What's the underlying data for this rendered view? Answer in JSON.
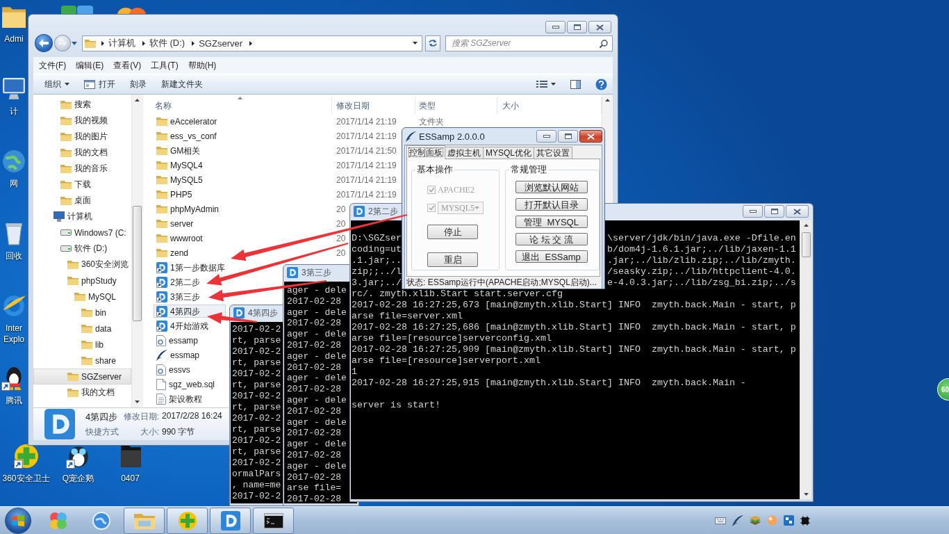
{
  "desktop": {
    "left_icons": [
      {
        "kind": "folder",
        "label": "Admi",
        "shortcut": false
      },
      {
        "kind": "computer",
        "label": "计",
        "shortcut": false
      },
      {
        "kind": "network",
        "label": "网",
        "shortcut": false
      },
      {
        "kind": "recycle-bin",
        "label": "回收",
        "shortcut": false
      },
      {
        "kind": "browser",
        "label": "Inter Explo",
        "shortcut": false
      },
      {
        "kind": "penguin",
        "label": "腾讯",
        "shortcut": true
      }
    ],
    "bottom_icons": [
      {
        "kind": "plus-shield",
        "label": "360安全卫士",
        "shortcut": true
      },
      {
        "kind": "pet",
        "label": "Q宠企鹅",
        "shortcut": true
      },
      {
        "kind": "dark-folder",
        "label": "0407",
        "shortcut": false
      }
    ],
    "side_widget": {
      "text": "60"
    }
  },
  "explorer": {
    "breadcrumb": [
      "计算机",
      "软件 (D:)",
      "SGZserver"
    ],
    "search": {
      "placeholder": "搜索 SGZserver"
    },
    "menu": [
      "文件(F)",
      "编辑(E)",
      "查看(V)",
      "工具(T)",
      "帮助(H)"
    ],
    "toolbar": [
      {
        "label": "组织",
        "kind": "menu"
      },
      {
        "label": "打开",
        "kind": "open"
      },
      {
        "label": "刻录",
        "kind": "plain"
      },
      {
        "label": "新建文件夹",
        "kind": "plain"
      }
    ],
    "nav_upper": [
      {
        "label": "搜索",
        "kind": "folder",
        "selected": false
      },
      {
        "label": "我的视频",
        "kind": "folder",
        "selected": false
      },
      {
        "label": "我的图片",
        "kind": "folder",
        "selected": false
      },
      {
        "label": "我的文档",
        "kind": "folder",
        "selected": false
      },
      {
        "label": "我的音乐",
        "kind": "folder",
        "selected": false
      },
      {
        "label": "下载",
        "kind": "folder",
        "selected": false
      },
      {
        "label": "桌面",
        "kind": "folder",
        "selected": false
      }
    ],
    "nav_tree": [
      {
        "label": "计算机",
        "kind": "computer",
        "selected": false,
        "children": [
          {
            "label": "Windows7 (C:",
            "kind": "drive",
            "selected": false
          },
          {
            "label": "软件 (D:)",
            "kind": "drive",
            "selected": false,
            "children": [
              {
                "label": "360安全浏览",
                "kind": "folder",
                "selected": false
              },
              {
                "label": "phpStudy",
                "kind": "folder",
                "selected": false,
                "children": [
                  {
                    "label": "MySQL",
                    "kind": "folder",
                    "selected": false,
                    "children": [
                      {
                        "label": "bin",
                        "kind": "folder",
                        "selected": false
                      },
                      {
                        "label": "data",
                        "kind": "folder",
                        "selected": false
                      },
                      {
                        "label": "lib",
                        "kind": "folder",
                        "selected": false
                      },
                      {
                        "label": "share",
                        "kind": "folder",
                        "selected": false
                      }
                    ]
                  }
                ]
              },
              {
                "label": "SGZserver",
                "kind": "folder",
                "selected": true
              },
              {
                "label": "我的文档",
                "kind": "folder",
                "selected": false
              }
            ]
          }
        ]
      }
    ],
    "columns": [
      "名称",
      "修改日期",
      "类型",
      "大小"
    ],
    "files": [
      {
        "name": "eAccelerator",
        "kind": "folder",
        "date": "2017/1/14 21:19",
        "type": "文件夹",
        "selected": false
      },
      {
        "name": "ess_vs_conf",
        "kind": "folder",
        "date": "2017/1/14 21:19",
        "selected": false
      },
      {
        "name": "GM相关",
        "kind": "folder",
        "date": "2017/1/14 21:50",
        "selected": false
      },
      {
        "name": "MySQL4",
        "kind": "folder",
        "date": "2017/1/14 21:19",
        "selected": false
      },
      {
        "name": "MySQL5",
        "kind": "folder",
        "date": "2017/1/14 21:19",
        "selected": false
      },
      {
        "name": "PHP5",
        "kind": "folder",
        "date": "2017/1/14 21:19",
        "selected": false
      },
      {
        "name": "phpMyAdmin",
        "kind": "folder",
        "date": "20",
        "selected": false
      },
      {
        "name": "server",
        "kind": "folder",
        "date": "20",
        "selected": false
      },
      {
        "name": "wwwroot",
        "kind": "folder",
        "date": "20",
        "selected": false
      },
      {
        "name": "zend",
        "kind": "folder",
        "date": "20",
        "selected": false
      },
      {
        "name": "1第一步数据库",
        "kind": "shortcut",
        "selected": false
      },
      {
        "name": "2第二步",
        "kind": "shortcut",
        "selected": false
      },
      {
        "name": "3第三步",
        "kind": "shortcut",
        "selected": false
      },
      {
        "name": "4第四步",
        "kind": "shortcut",
        "selected": true
      },
      {
        "name": "4开始游戏",
        "kind": "shortcut",
        "selected": false
      },
      {
        "name": "essamp",
        "kind": "config",
        "selected": false
      },
      {
        "name": "essmap",
        "kind": "feather",
        "selected": false
      },
      {
        "name": "essvs",
        "kind": "config",
        "selected": false
      },
      {
        "name": "sgz_web.sql",
        "kind": "file",
        "selected": false
      },
      {
        "name": "架设教程",
        "kind": "document",
        "selected": false
      }
    ],
    "details": {
      "name": "4第四步",
      "date_label": "修改日期:",
      "date": "2017/2/28 16:24",
      "type": "快捷方式",
      "size_label": "大小:",
      "size": "990 字节"
    }
  },
  "consoles": [
    {
      "title": "4第四步",
      "lines": [
        {
          "text": "2017-02-2"
        },
        {
          "text": "rt, parse"
        },
        {
          "text": "2017-02-2"
        },
        {
          "text": "rt, parse"
        },
        {
          "text": "2017-02-2"
        },
        {
          "text": "rt, parse"
        },
        {
          "text": "2017-02-2"
        },
        {
          "text": "rt, parse"
        },
        {
          "text": "2017-02-2"
        },
        {
          "text": "rt, parse"
        },
        {
          "text": "2017-02-2"
        },
        {
          "text": "rt, parse"
        },
        {
          "text": "2017-02-2"
        },
        {
          "text": "ormalPars"
        },
        {
          "text": ", name=me"
        },
        {
          "text": "2017-02-2"
        }
      ]
    },
    {
      "title": "3第三步",
      "lines": [
        {
          "text": "ager - dele"
        },
        {
          "text": "2017-02-28"
        },
        {
          "text": "ager - dele"
        },
        {
          "text": "2017-02-28"
        },
        {
          "text": "ager - dele"
        },
        {
          "text": "2017-02-28"
        },
        {
          "text": "ager - dele"
        },
        {
          "text": "2017-02-28"
        },
        {
          "text": "ager - dele"
        },
        {
          "text": "2017-02-28"
        },
        {
          "text": "ager - dele"
        },
        {
          "text": "2017-02-28"
        },
        {
          "text": "ager - dele"
        },
        {
          "text": "2017-02-28"
        },
        {
          "text": "ager - dele"
        },
        {
          "text": "2017-02-28"
        },
        {
          "text": "ager - dele"
        },
        {
          "text": "2017-02-28"
        },
        {
          "text": "arse file="
        },
        {
          "text": "2017-02-28"
        }
      ]
    },
    {
      "title": "2第二步",
      "lines": [
        {
          "kind": "split",
          "left": "D:\\SGZser",
          "right": "\\server/jdk/bin/java.exe -Dfile.en"
        },
        {
          "kind": "split",
          "left": "coding=ut",
          "right": "b/dom4j-1.6.1.jar;../lib/jaxen-1.1"
        },
        {
          "kind": "split",
          "left": ".1.jar;..",
          "right": ".jar;../lib/zlib.zip;../lib/zmyth."
        },
        {
          "kind": "split",
          "left": "zip;;../l",
          "right": "/seasky.zip;../lib/httpclient-4.0."
        },
        {
          "kind": "split",
          "left": "3.jar;../",
          "right": "e-4.0.3.jar;../lib/zsg_bi.zip;../s"
        },
        {
          "kind": "text",
          "text": "rc/. zmyth.xlib.Start start.server.cfg"
        },
        {
          "kind": "text",
          "text": "2017-02-28 16:27:25,673 [main@zmyth.xlib.Start] INFO  zmyth.back.Main - start, p"
        },
        {
          "kind": "text",
          "text": "arse file=server.xml"
        },
        {
          "kind": "text",
          "text": "2017-02-28 16:27:25,686 [main@zmyth.xlib.Start] INFO  zmyth.back.Main - start, p"
        },
        {
          "kind": "text",
          "text": "arse file=[resource]serverconfig.xml"
        },
        {
          "kind": "text",
          "text": "2017-02-28 16:27:25,909 [main@zmyth.xlib.Start] INFO  zmyth.back.Main - start, p"
        },
        {
          "kind": "text",
          "text": "arse file=[resource]serverport.xml"
        },
        {
          "kind": "text",
          "text": "1"
        },
        {
          "kind": "text",
          "text": "2017-02-28 16:27:25,915 [main@zmyth.xlib.Start] INFO  zmyth.back.Main -"
        },
        {
          "kind": "blank"
        },
        {
          "kind": "text",
          "text": "server is start!"
        }
      ]
    }
  ],
  "essamp": {
    "title": "ESSamp 2.0.0.0",
    "tabs": [
      {
        "label": "控制面板",
        "selected": true
      },
      {
        "label": "虚拟主机",
        "selected": false
      },
      {
        "label": "MYSQL优化",
        "selected": false
      },
      {
        "label": "其它设置",
        "selected": false
      }
    ],
    "basic": {
      "title": "基本操作",
      "options": [
        {
          "label": "APACHE2",
          "checked": true,
          "disabled": true
        },
        {
          "dropdown": "MYSQL5",
          "checked": true,
          "disabled": true
        }
      ],
      "buttons": [
        "停止",
        "重启"
      ]
    },
    "manage": {
      "title": "常规管理",
      "buttons": [
        "浏览默认网站",
        "打开默认目录",
        "管理  MYSQL",
        "论 坛 交 流",
        "退出  ESSamp"
      ]
    },
    "status": "状态: ESSamp运行中(APACHE启动;MYSQL启动)..."
  },
  "taskbar": {
    "buttons": [
      {
        "kind": "colorful",
        "running": false
      },
      {
        "kind": "globe",
        "running": false
      },
      {
        "kind": "folder",
        "running": true
      },
      {
        "kind": "plus",
        "running": true
      },
      {
        "kind": "d-app",
        "running": true
      },
      {
        "kind": "console",
        "running": true
      }
    ]
  }
}
